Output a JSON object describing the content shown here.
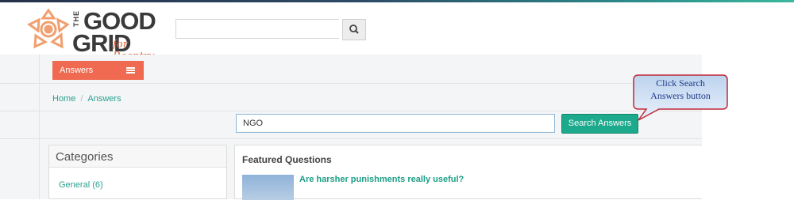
{
  "logo": {
    "the": "THE",
    "good": "GOOD",
    "grid": "GRID",
    "tagline": "for Reentry"
  },
  "header": {
    "search_placeholder": "",
    "search_icon": "search-icon"
  },
  "nav": {
    "section_label": "Answers",
    "menu_icon": "hamburger-icon"
  },
  "breadcrumb": {
    "home": "Home",
    "separator": "/",
    "current": "Answers"
  },
  "answer_search": {
    "value": "NGO",
    "button_label": "Search Answers"
  },
  "categories": {
    "heading": "Categories",
    "items": [
      "General (6)"
    ]
  },
  "featured": {
    "heading": "Featured Questions",
    "questions": [
      "Are harsher punishments really useful?"
    ]
  },
  "callout": {
    "text": "Click Search Answers button"
  },
  "colors": {
    "accent": "#ef6a50",
    "button": "#1da98b",
    "link": "#2aa190",
    "callout_text": "#1e3a8a"
  }
}
